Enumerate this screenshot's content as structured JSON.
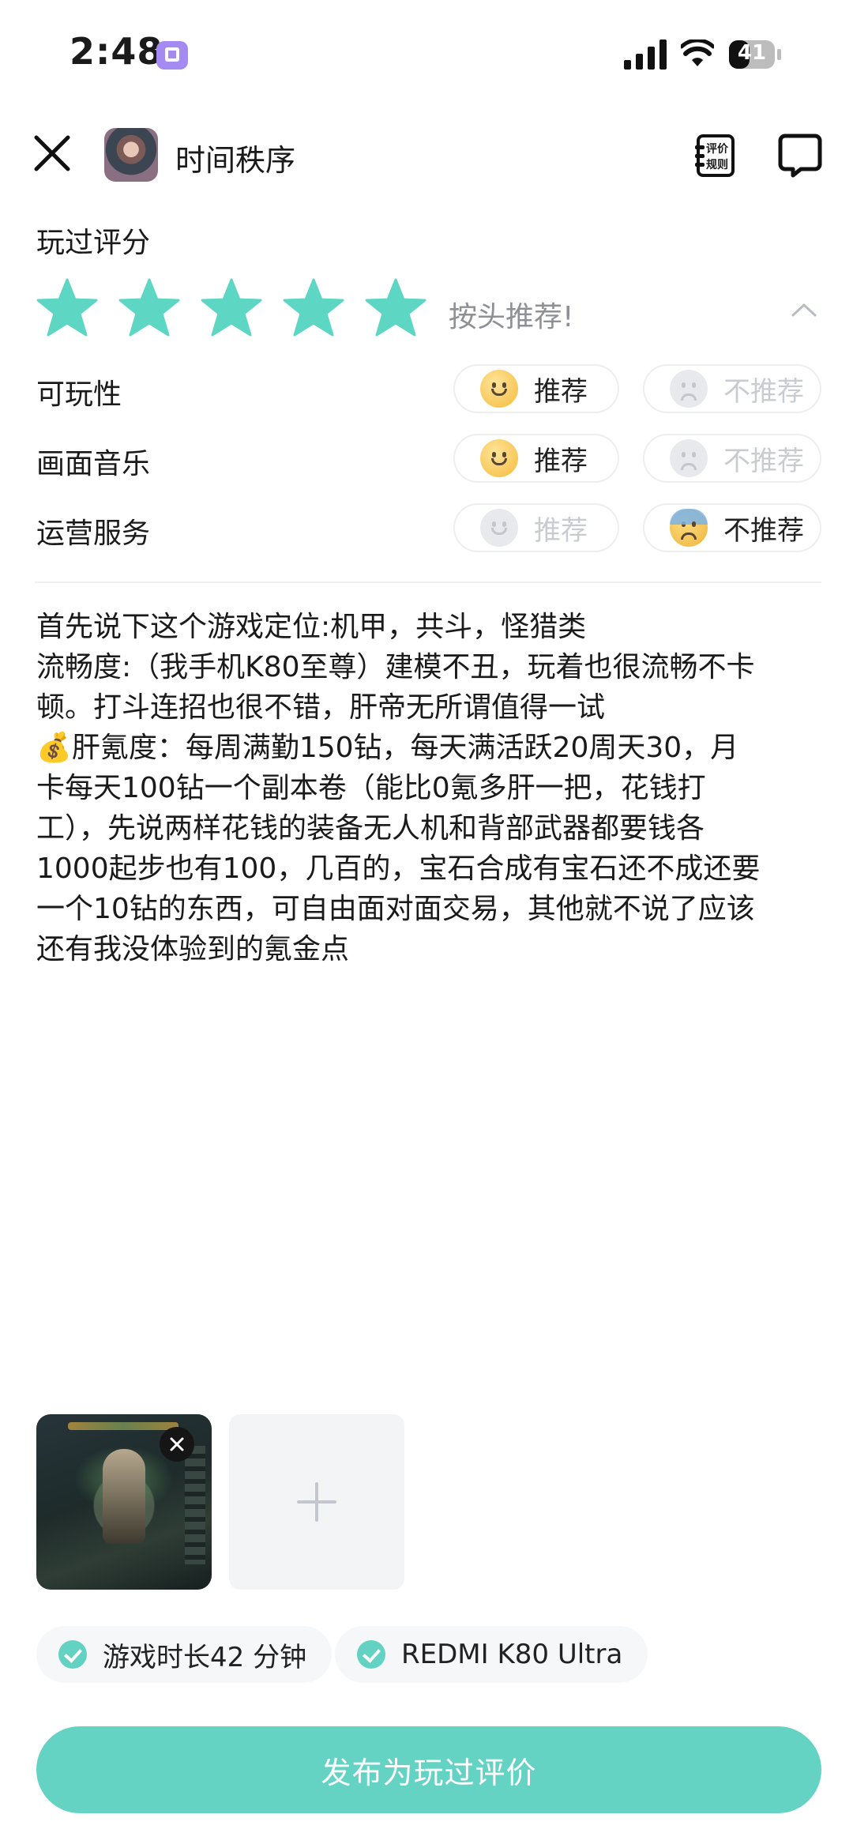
{
  "status_bar": {
    "time": "2:48",
    "battery": "41"
  },
  "header": {
    "game_title": "时间秩序",
    "rules_label_1": "评价",
    "rules_label_2": "规则"
  },
  "rating": {
    "section_title": "玩过评分",
    "stars": 5,
    "rating_text": "按头推荐!",
    "star_color": "#5dd6c4",
    "categories": [
      {
        "label": "可玩性",
        "recommend": "推荐",
        "not_recommend": "不推荐",
        "selected": "recommend"
      },
      {
        "label": "画面音乐",
        "recommend": "推荐",
        "not_recommend": "不推荐",
        "selected": "recommend"
      },
      {
        "label": "运营服务",
        "recommend": "推荐",
        "not_recommend": "不推荐",
        "selected": "not_recommend"
      }
    ]
  },
  "review": {
    "lines": [
      "首先说下这个游戏定位:机甲，共斗，怪猎类",
      "流畅度:（我手机K80至尊）建模不丑，玩着也很流畅不卡",
      "顿。打斗连招也很不错，肝帝无所谓值得一试",
      "💰肝氪度：每周满勤150钻，每天满活跃20周天30，月",
      "卡每天100钻一个副本卷（能比0氪多肝一把，花钱打",
      "工），先说两样花钱的装备无人机和背部武器都要钱各",
      "1000起步也有100，几百的，宝石合成有宝石还不成还要",
      "一个10钻的东西，可自由面对面交易，其他就不说了应该",
      "还有我没体验到的氪金点"
    ]
  },
  "tags": {
    "play_time": "游戏时长42 分钟",
    "device": "REDMI K80 Ultra"
  },
  "publish_button": "发布为玩过评价",
  "colors": {
    "accent": "#64d3c3",
    "muted": "#8e9096"
  }
}
